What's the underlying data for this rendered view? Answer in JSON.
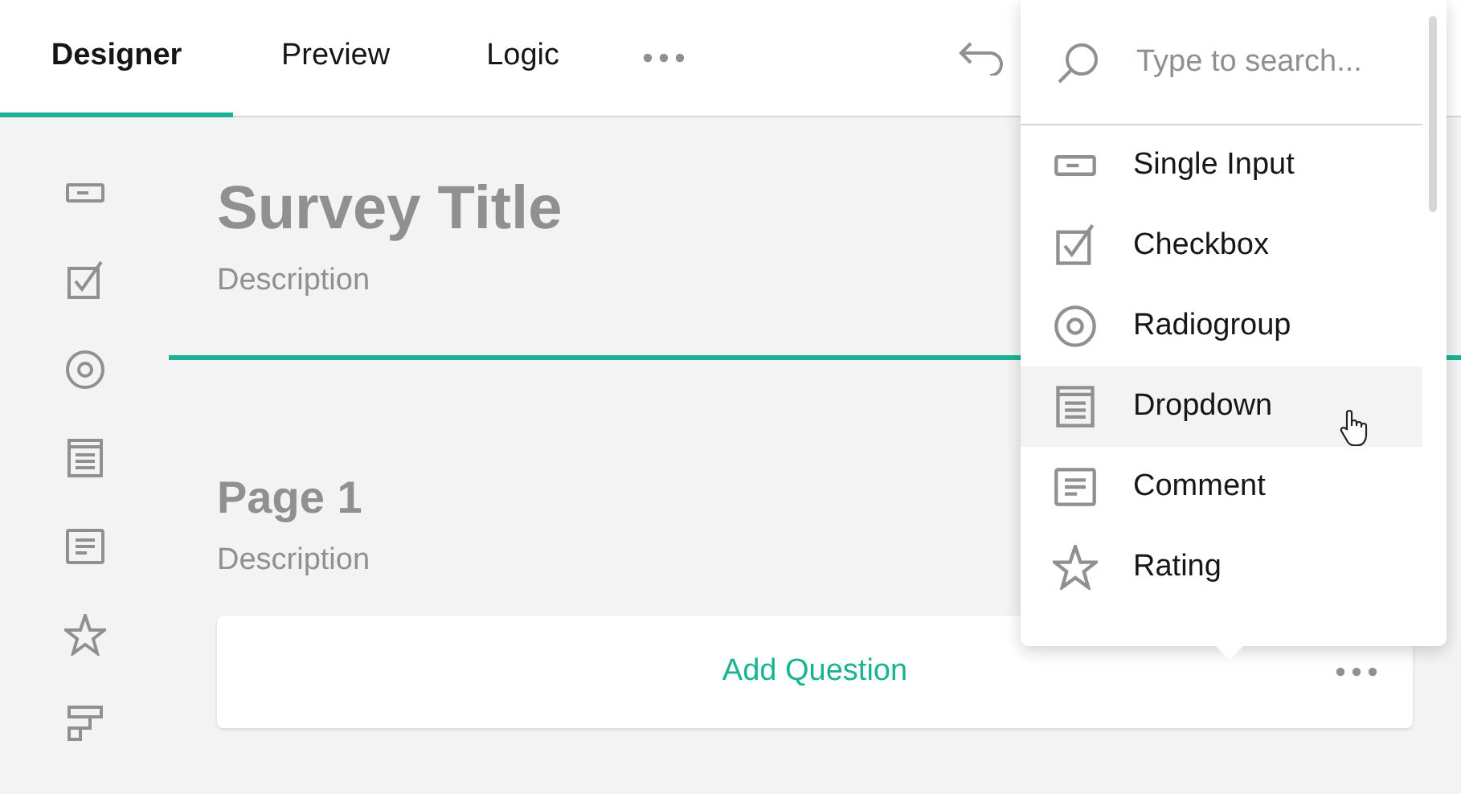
{
  "tabs": [
    {
      "label": "Designer",
      "selected": true
    },
    {
      "label": "Preview",
      "selected": false
    },
    {
      "label": "Logic",
      "selected": false
    }
  ],
  "toolbox": [
    {
      "kind": "text"
    },
    {
      "kind": "checkbox"
    },
    {
      "kind": "radiogroup"
    },
    {
      "kind": "dropdown"
    },
    {
      "kind": "comment"
    },
    {
      "kind": "rating"
    },
    {
      "kind": "ranking"
    }
  ],
  "survey": {
    "title": "Survey Title",
    "description": "Description"
  },
  "page": {
    "title": "Page 1",
    "description": "Description",
    "add_button": "Add Question"
  },
  "popup": {
    "search": {
      "placeholder": "Type to search..."
    },
    "items": [
      {
        "kind": "text",
        "label": "Single Input",
        "selected": false
      },
      {
        "kind": "checkbox",
        "label": "Checkbox",
        "selected": false
      },
      {
        "kind": "radiogroup",
        "label": "Radiogroup",
        "selected": false
      },
      {
        "kind": "dropdown",
        "label": "Dropdown",
        "selected": true
      },
      {
        "kind": "comment",
        "label": "Comment",
        "selected": false
      },
      {
        "kind": "rating",
        "label": "Rating",
        "selected": false
      }
    ]
  }
}
